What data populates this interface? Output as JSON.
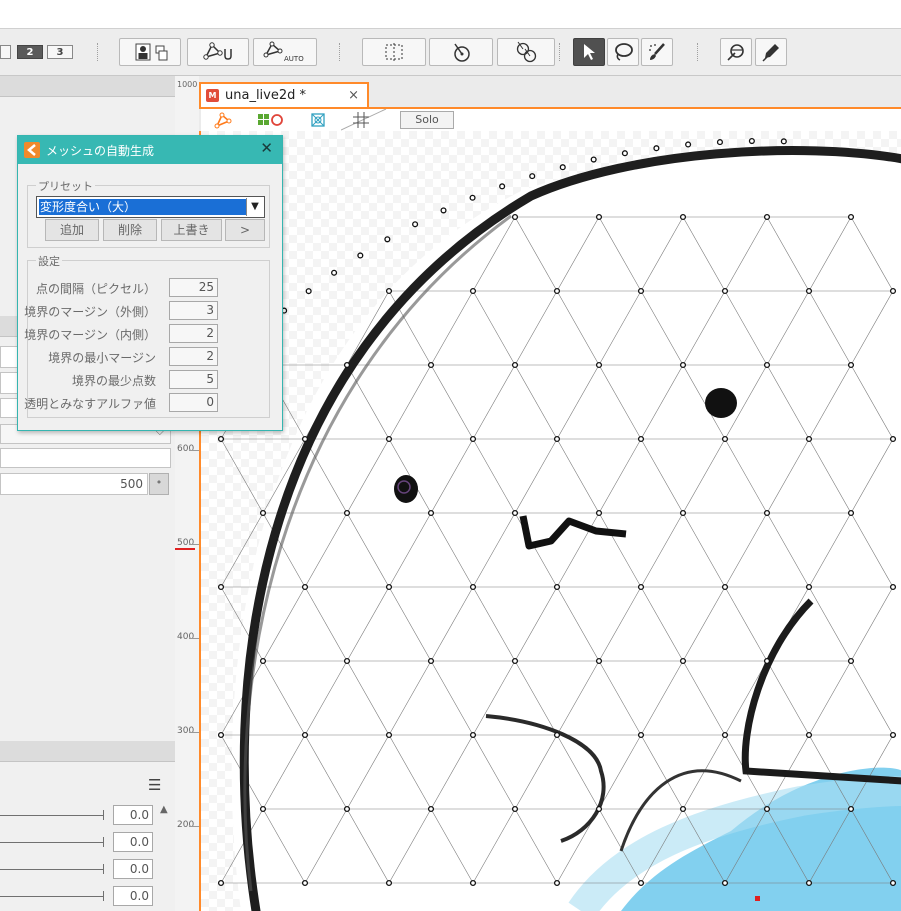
{
  "toolbar": {
    "page_buttons": [
      "2",
      "3"
    ]
  },
  "document": {
    "tab_title": "una_live2d *",
    "close_glyph": "×",
    "solo_label": "Solo"
  },
  "ruler": {
    "top_label": "1000",
    "labels": [
      "600",
      "500",
      "400",
      "300",
      "200"
    ]
  },
  "left_panel": {
    "value_500": "500",
    "slider_values": [
      "0.0",
      "0.0",
      "0.0",
      "0.0"
    ]
  },
  "dialog": {
    "title": "メッシュの自動生成",
    "close_glyph": "✕",
    "preset_group_label": "プリセット",
    "preset_selected": "変形度合い（大）",
    "buttons": {
      "add": "追加",
      "delete": "削除",
      "overwrite": "上書き",
      "more": ">"
    },
    "settings_group_label": "設定",
    "settings": [
      {
        "label": "点の間隔（ピクセル）",
        "value": "25"
      },
      {
        "label": "境界のマージン（外側）",
        "value": "3"
      },
      {
        "label": "境界のマージン（内側）",
        "value": "2"
      },
      {
        "label": "境界の最小マージン",
        "value": "2"
      },
      {
        "label": "境界の最少点数",
        "value": "5"
      },
      {
        "label": "透明とみなすアルファ値",
        "value": "0"
      }
    ]
  },
  "colors": {
    "accent_orange": "#ff8a2a",
    "dialog_teal": "#37b8b3",
    "selection_blue": "#1a6fd6",
    "water_blue": "#6cc8ec"
  }
}
